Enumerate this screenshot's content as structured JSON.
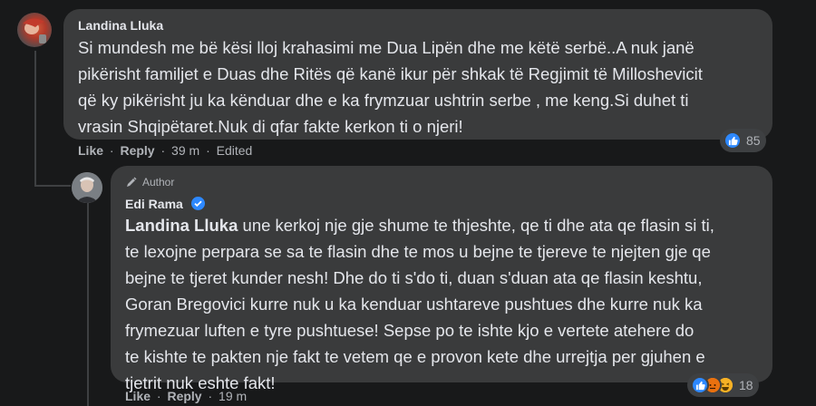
{
  "comments": [
    {
      "author": "Landina Lluka",
      "text_lines": [
        "Si mundesh me bë kësi lloj krahasimi me Dua Lipën dhe me këtë serbë..A nuk janë",
        "pikërisht familjet e Duas dhe Ritës që kanë ikur për shkak të Regjimit të Milloshevicit",
        "që ky pikërisht ju ka kënduar dhe e ka frymzuar ushtrin serbe , me keng.Si duhet ti",
        "vrasin Shqipëtaret.Nuk di qfar fakte kerkon ti o njeri!"
      ],
      "actions": {
        "like": "Like",
        "reply": "Reply",
        "time": "39 m",
        "edited": "Edited"
      },
      "reactions": {
        "count": "85",
        "icons": [
          "like-icon"
        ],
        "colors": {
          "like": "#2d88ff"
        }
      }
    },
    {
      "author_badge": "Author",
      "author": "Edi Rama",
      "verified": true,
      "mention": "Landina Lluka",
      "text_lines": [
        " une kerkoj nje gje shume te thjeshte, qe ti dhe ata qe flasin si ti,",
        "te lexojne perpara se sa te flasin dhe te mos u bejne te tjereve te njejten gje qe",
        "bejne te tjeret kunder nesh! Dhe do ti s'do ti, duan s'duan ata qe flasin keshtu,",
        "Goran Bregovici kurre nuk u ka kenduar ushtareve pushtues dhe kurre nuk ka",
        "frymezuar luften e tyre pushtuese! Sepse po te ishte kjo e vertete atehere do",
        "te kishte te pakten nje fakt te vetem qe e provon kete dhe urrejtja per gjuhen e",
        "tjetrit nuk eshte fakt!"
      ],
      "actions": {
        "like": "Like",
        "reply": "Reply",
        "time": "19 m"
      },
      "reactions": {
        "count": "18",
        "icons": [
          "like-icon",
          "angry-icon",
          "haha-icon"
        ],
        "colors": {
          "like": "#2d88ff",
          "angry": "#e9710f",
          "haha": "#f7b125"
        }
      }
    }
  ],
  "dot_separator": "·"
}
